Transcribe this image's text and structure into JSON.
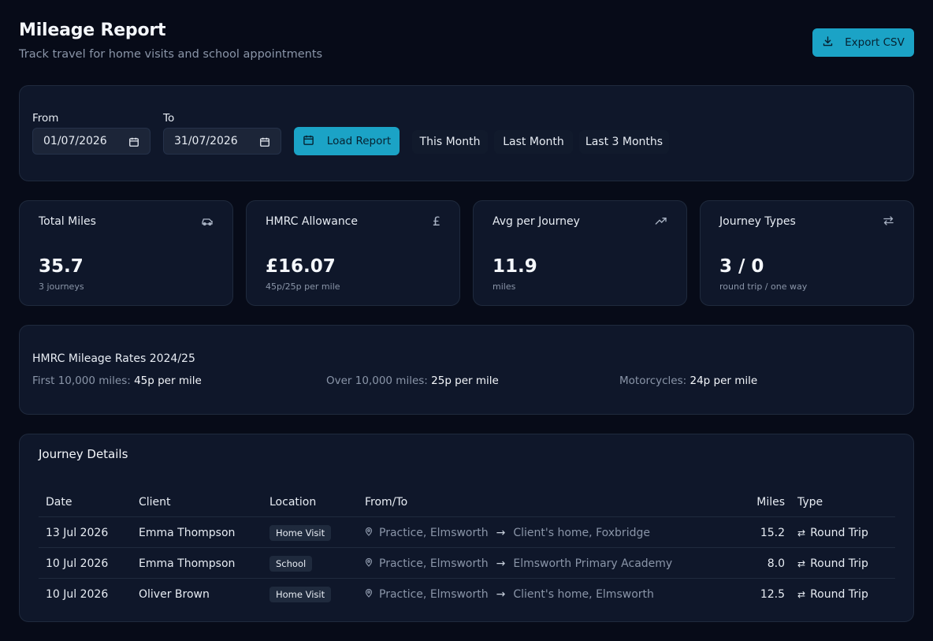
{
  "header": {
    "title": "Mileage Report",
    "subtitle": "Track travel for home visits and school appointments",
    "export_label": "Export CSV"
  },
  "filters": {
    "from_label": "From",
    "from_value": "01/07/2026",
    "to_label": "To",
    "to_value": "31/07/2026",
    "load_label": "Load Report",
    "quick": [
      "This Month",
      "Last Month",
      "Last 3 Months"
    ]
  },
  "stats": [
    {
      "label": "Total Miles",
      "icon": "car-icon",
      "value": "35.7",
      "sub": "3 journeys"
    },
    {
      "label": "HMRC Allowance",
      "icon": "pound-icon",
      "value": "£16.07",
      "sub": "45p/25p per mile"
    },
    {
      "label": "Avg per Journey",
      "icon": "trending-up-icon",
      "value": "11.9",
      "sub": "miles"
    },
    {
      "label": "Journey Types",
      "icon": "swap-icon",
      "value": "3 / 0",
      "sub": "round trip / one way"
    }
  ],
  "rates": {
    "title": "HMRC Mileage Rates 2024/25",
    "items": [
      {
        "label": "First 10,000 miles:",
        "value": "45p per mile"
      },
      {
        "label": "Over 10,000 miles:",
        "value": "25p per mile"
      },
      {
        "label": "Motorcycles:",
        "value": "24p per mile"
      }
    ]
  },
  "journeys": {
    "title": "Journey Details",
    "columns": [
      "Date",
      "Client",
      "Location",
      "From/To",
      "Miles",
      "Type"
    ],
    "rows": [
      {
        "date": "13 Jul 2026",
        "client": "Emma Thompson",
        "location": "Home Visit",
        "from": "Practice, Elmsworth",
        "to": "Client's home, Foxbridge",
        "miles": "15.2",
        "type": "Round Trip"
      },
      {
        "date": "10 Jul 2026",
        "client": "Emma Thompson",
        "location": "School",
        "from": "Practice, Elmsworth",
        "to": "Elmsworth Primary Academy",
        "miles": "8.0",
        "type": "Round Trip"
      },
      {
        "date": "10 Jul 2026",
        "client": "Oliver Brown",
        "location": "Home Visit",
        "from": "Practice, Elmsworth",
        "to": "Client's home, Elmsworth",
        "miles": "12.5",
        "type": "Round Trip"
      }
    ]
  },
  "colors": {
    "accent": "#1ba3c6",
    "background": "#070b18",
    "panel": "#0f172a"
  }
}
